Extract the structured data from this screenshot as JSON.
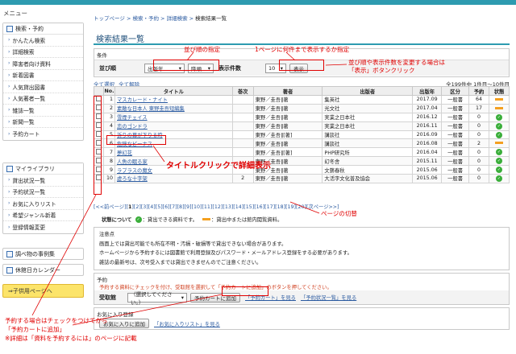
{
  "sidebar": {
    "menu_label": "メニュー",
    "groups": [
      {
        "head": "検索・予約",
        "items": [
          "かんたん検索",
          "詳細検索",
          "障害者向け資料",
          "新着図書",
          "人気貸出図書",
          "人気著者一覧",
          "雑誌一覧",
          "新聞一覧",
          "予約カート"
        ]
      },
      {
        "head": "マイライブラリ",
        "items": [
          "貸出状況一覧",
          "予約状況一覧",
          "お気に入りリスト",
          "希望ジャンル新着",
          "登録情報変更"
        ]
      }
    ],
    "singles": [
      "調べ物の事例集",
      "休館日カレンダー"
    ],
    "child_page": "⇒子供用ページへ"
  },
  "breadcrumb": [
    "トップページ",
    "検索・予約",
    "詳細検索",
    "検索結果一覧"
  ],
  "page_title": "検索結果一覧",
  "conditions": {
    "label": "条件",
    "sort_label": "並び順",
    "sort_field": "出版年",
    "sort_dir": "降順",
    "per_page_label": "表示件数",
    "per_page": "10",
    "display_button": "表示"
  },
  "select_all": "全て選択",
  "deselect_all": "全て解除",
  "result_count": "全199件中 1件目〜10件目",
  "table": {
    "headers": [
      "No.",
      "タイトル",
      "巻次",
      "著者",
      "出版者",
      "出版年",
      "区分",
      "予約",
      "状態"
    ],
    "rows": [
      {
        "no": "1",
        "title": "マスカレード・ナイト",
        "vol": "",
        "author": "東野／圭吾‖著",
        "pub": "集英社",
        "year": "2017.09",
        "cat": "一般書",
        "res": "64",
        "status": "out"
      },
      {
        "no": "2",
        "title": "素敵な日本人 東野圭吾短編集",
        "vol": "",
        "author": "東野／圭吾‖著",
        "pub": "光文社",
        "year": "2017.04",
        "cat": "一般書",
        "res": "17",
        "status": "out"
      },
      {
        "no": "3",
        "title": "雪煙チェイス",
        "vol": "",
        "author": "東野／圭吾‖著",
        "pub": "実業之日本社",
        "year": "2016.12",
        "cat": "一般書",
        "res": "0",
        "status": "ok"
      },
      {
        "no": "4",
        "title": "恋のゴンドラ",
        "vol": "",
        "author": "東野／圭吾‖著",
        "pub": "実業之日本社",
        "year": "2016.11",
        "cat": "一般書",
        "res": "0",
        "status": "ok"
      },
      {
        "no": "5",
        "title": "祈りの幕が下りる時",
        "vol": "",
        "author": "東野／圭吾‖[著]",
        "pub": "講談社",
        "year": "2016.09",
        "cat": "一般書",
        "res": "0",
        "status": "ok"
      },
      {
        "no": "6",
        "title": "危険なビーナス",
        "vol": "",
        "author": "東野／圭吾‖著",
        "pub": "講談社",
        "year": "2016.08",
        "cat": "一般書",
        "res": "2",
        "status": "out"
      },
      {
        "no": "7",
        "title": "夢幻花",
        "vol": "",
        "author": "東野／圭吾‖[著]",
        "pub": "PHP研究所",
        "year": "2016.04",
        "cat": "一般書",
        "res": "0",
        "status": "ok"
      },
      {
        "no": "8",
        "title": "人魚の眠る家",
        "vol": "",
        "author": "東野／圭吾‖著",
        "pub": "幻冬舎",
        "year": "2015.11",
        "cat": "一般書",
        "res": "0",
        "status": "ok"
      },
      {
        "no": "9",
        "title": "ラプラスの魔女",
        "vol": "",
        "author": "東野／圭吾‖著",
        "pub": "文藝春秋",
        "year": "2015.06",
        "cat": "一般書",
        "res": "0",
        "status": "ok"
      },
      {
        "no": "10",
        "title": "虚ろな十字架",
        "vol": "2",
        "author": "東野／圭吾‖著",
        "pub": "大活字文化普及協会",
        "year": "2015.06",
        "cat": "一般書",
        "res": "0",
        "status": "ok"
      }
    ]
  },
  "pager": {
    "prev": "[<<前ページ]",
    "pages": [
      "1",
      "2",
      "3",
      "4",
      "5",
      "6",
      "7",
      "8",
      "9",
      "10",
      "11",
      "12",
      "13",
      "14",
      "15",
      "16",
      "17",
      "18",
      "19",
      "20"
    ],
    "current": "1",
    "next": "[次ページ>>]"
  },
  "legend": {
    "label": "状態について",
    "ok": "：貸出できる資料です。",
    "out": "：貸出中または館内閲覧資料。"
  },
  "notes": {
    "title": "注意点",
    "lines": [
      "画面上では貸出可能でも所在不明・汚損・破損等で貸出できない場合があります。",
      "ホームページから予約するには図書館で利用登録及びパスワード・メールアドレス登録をする必要があります。",
      "雑誌の最新号は、次号受入までは貸出できませんのでご注意ください。"
    ]
  },
  "reserve": {
    "title": "予約",
    "message": "予約する資料にチェックを付け、受取館を選択して「予約カートに追加」のボタンを押してください。",
    "pickup_label": "受取館",
    "pickup_value": "（選択してください。）",
    "add_button": "予約カートに追加",
    "cart_link": "「予約カート」を見る",
    "status_link": "「予約状況一覧」を見る"
  },
  "favorites": {
    "title": "お気に入り登録",
    "add_button": "お気に入りに追加",
    "view_link": "「お気に入りリスト」を見る"
  },
  "annotations": {
    "sort_note": "並び順の指定",
    "per_page_note": "1ページに何件まで表示するか指定",
    "display_note_1": "並び順や表示件数を変更する場合は",
    "display_note_2": "「表示」ボタンクリック",
    "title_note": "タイトルクリックで詳細表示",
    "pager_note": "ページの切替",
    "reserve_note_1": "予約する場合はチェックをつけてから",
    "reserve_note_2": "「予約カートに追加」",
    "reserve_note_3": "※詳細は「資料を予約するには」のページに記載"
  },
  "colors": {
    "accent": "#2e9bb0",
    "annotation": "#e00000",
    "link": "#2a5aa0",
    "child_btn": "#fce46a"
  }
}
